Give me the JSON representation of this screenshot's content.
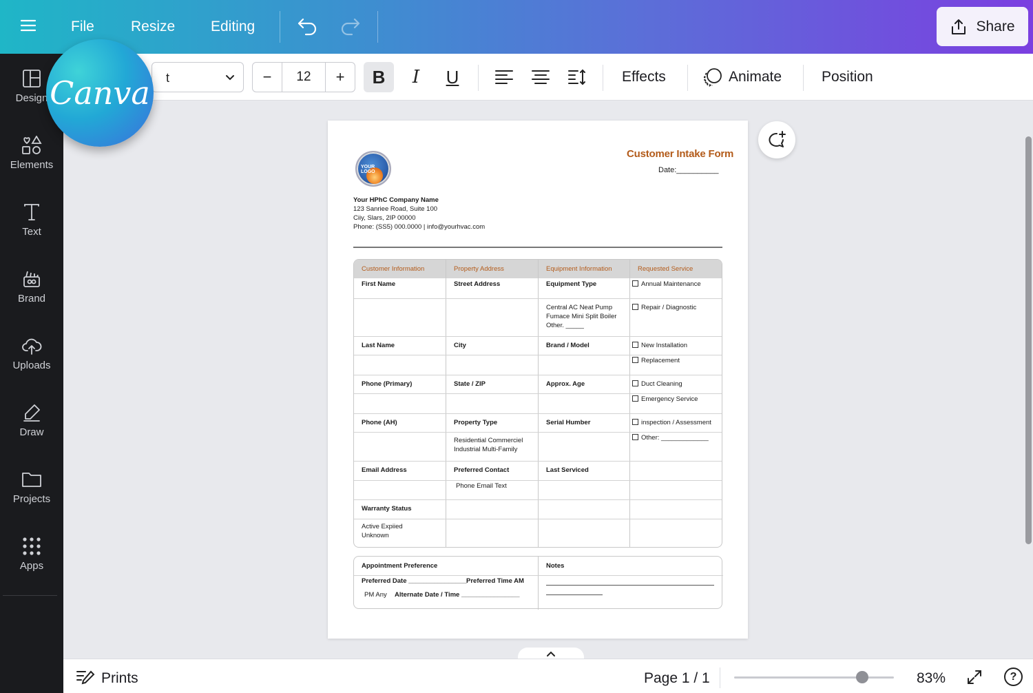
{
  "topbar": {
    "file": "File",
    "resize": "Resize",
    "editing": "Editing",
    "share": "Share"
  },
  "logo": {
    "text": "Canva"
  },
  "sidebar": {
    "items": [
      {
        "label": "Design",
        "icon": "layout-icon"
      },
      {
        "label": "Elements",
        "icon": "shapes-icon"
      },
      {
        "label": "Text",
        "icon": "text-icon"
      },
      {
        "label": "Brand",
        "icon": "brand-icon"
      },
      {
        "label": "Uploads",
        "icon": "upload-cloud-icon"
      },
      {
        "label": "Draw",
        "icon": "pen-icon"
      },
      {
        "label": "Projects",
        "icon": "folder-icon"
      },
      {
        "label": "Apps",
        "icon": "apps-grid-icon"
      }
    ]
  },
  "toolbar": {
    "font": "t",
    "font_size": "12",
    "minus": "−",
    "plus": "+",
    "bold": "B",
    "italic": "I",
    "underline": "U",
    "effects": "Effects",
    "animate": "Animate",
    "position": "Position"
  },
  "doc": {
    "title": "Customer Intake Form",
    "date": "Date:__________",
    "logo_text": "YOUR LOGO",
    "company": {
      "name": "Your HPhC Company Name",
      "address": "123 Sanriee Road, Suite 100",
      "city": "Ciiy, Slars, 2IP 00000",
      "contact": "Phone: (SS5) 000.0000 | info@yourhvac.com"
    },
    "headers": [
      "Customer Information",
      "Property Address",
      "Equipment Information",
      "Requested Service"
    ],
    "col1": [
      "First Name",
      "Last Name",
      "Phone (Primary)",
      "Phone (AH)",
      "Email Address",
      "Warranty Status",
      "Active   Expiied",
      "Unknown"
    ],
    "col2": [
      "Street Address",
      "City",
      "State / ZIP",
      "Property Type",
      "Residential   Commerciel",
      "Industrial   Multi-Family",
      "Preferred Contact",
      "Phone   Email   Text"
    ],
    "col3": [
      "Equipment Type",
      "Central AC   Neat Pump",
      "Fumace   Mini Split   Boiler",
      "Other. _____",
      "Brand / Model",
      "Approx. Age",
      "Serial Humber",
      "Last Serviced"
    ],
    "col4": [
      "Annual Maintenance",
      "Repair / Diagnostic",
      "New Installation",
      "Replacement",
      "Duct Cleaning",
      "Emergency Service",
      "inspection / Assessment",
      "Other: _____________"
    ],
    "appt": {
      "title": "Appointment Preference",
      "line1a": "Preferred Date ________________",
      "line1b": "Preferred Time   AM",
      "line2a": "PM   Any",
      "line2b": "Alternate Date / Time ________________"
    },
    "notes": "Notes"
  },
  "status": {
    "prints": "Prints",
    "page": "Page 1 / 1",
    "zoom": "83%",
    "zoom_fraction": 0.8,
    "help": "?"
  }
}
